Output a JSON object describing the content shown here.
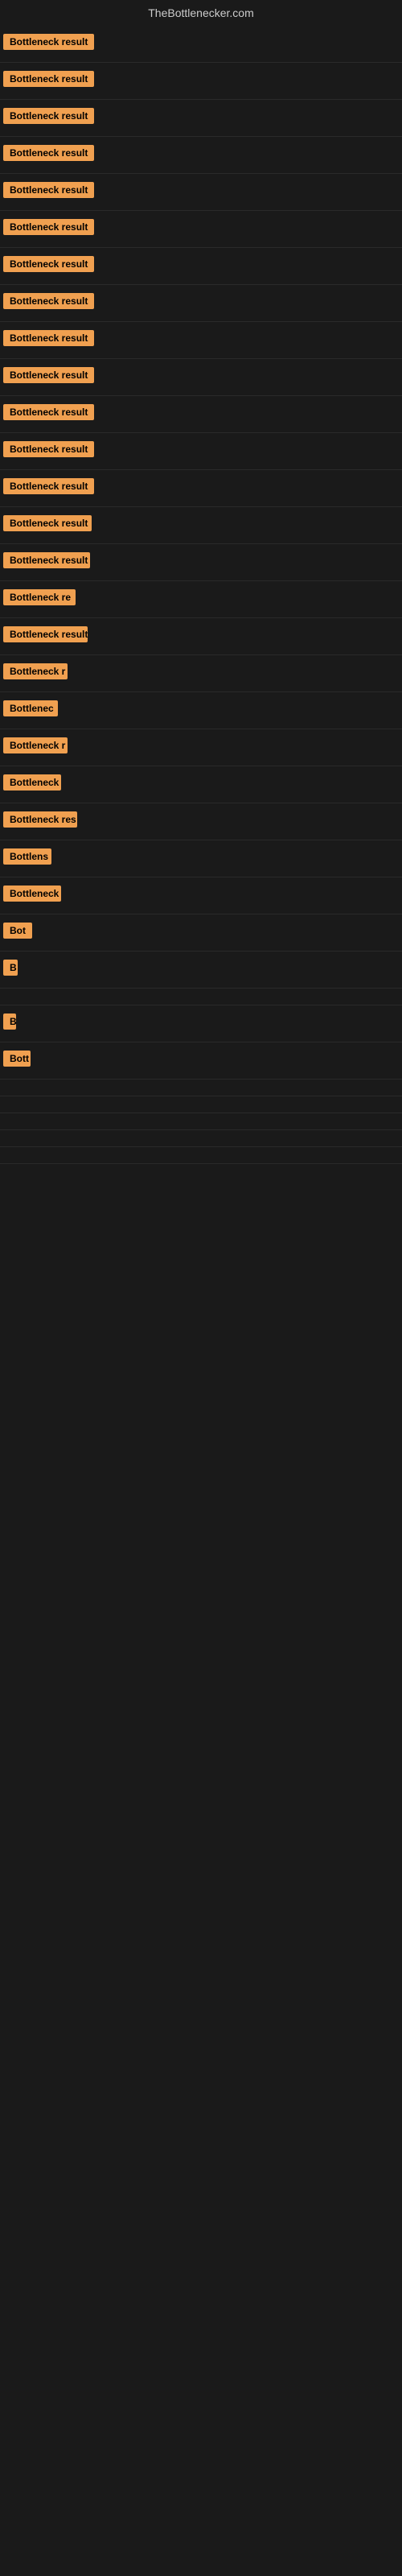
{
  "site": {
    "title": "TheBottlenecker.com"
  },
  "rows": [
    {
      "id": 1,
      "label": "Bottleneck result",
      "width": 140
    },
    {
      "id": 2,
      "label": "Bottleneck result",
      "width": 135
    },
    {
      "id": 3,
      "label": "Bottleneck result",
      "width": 130
    },
    {
      "id": 4,
      "label": "Bottleneck result",
      "width": 128
    },
    {
      "id": 5,
      "label": "Bottleneck result",
      "width": 130
    },
    {
      "id": 6,
      "label": "Bottleneck result",
      "width": 128
    },
    {
      "id": 7,
      "label": "Bottleneck result",
      "width": 128
    },
    {
      "id": 8,
      "label": "Bottleneck result",
      "width": 125
    },
    {
      "id": 9,
      "label": "Bottleneck result",
      "width": 123
    },
    {
      "id": 10,
      "label": "Bottleneck result",
      "width": 121
    },
    {
      "id": 11,
      "label": "Bottleneck result",
      "width": 120
    },
    {
      "id": 12,
      "label": "Bottleneck result",
      "width": 115
    },
    {
      "id": 13,
      "label": "Bottleneck result",
      "width": 113
    },
    {
      "id": 14,
      "label": "Bottleneck result",
      "width": 110
    },
    {
      "id": 15,
      "label": "Bottleneck result",
      "width": 108
    },
    {
      "id": 16,
      "label": "Bottleneck re",
      "width": 90
    },
    {
      "id": 17,
      "label": "Bottleneck result",
      "width": 105
    },
    {
      "id": 18,
      "label": "Bottleneck r",
      "width": 80
    },
    {
      "id": 19,
      "label": "Bottlenec",
      "width": 68
    },
    {
      "id": 20,
      "label": "Bottleneck r",
      "width": 80
    },
    {
      "id": 21,
      "label": "Bottleneck",
      "width": 72
    },
    {
      "id": 22,
      "label": "Bottleneck res",
      "width": 92
    },
    {
      "id": 23,
      "label": "Bottlens",
      "width": 60
    },
    {
      "id": 24,
      "label": "Bottleneck",
      "width": 72
    },
    {
      "id": 25,
      "label": "Bot",
      "width": 36
    },
    {
      "id": 26,
      "label": "B",
      "width": 18
    },
    {
      "id": 27,
      "label": "",
      "width": 0
    },
    {
      "id": 28,
      "label": "B",
      "width": 16
    },
    {
      "id": 29,
      "label": "Bott",
      "width": 34
    },
    {
      "id": 30,
      "label": "",
      "width": 0
    },
    {
      "id": 31,
      "label": "",
      "width": 0
    },
    {
      "id": 32,
      "label": "",
      "width": 0
    },
    {
      "id": 33,
      "label": "",
      "width": 0
    },
    {
      "id": 34,
      "label": "",
      "width": 0
    },
    {
      "id": 35,
      "label": "",
      "width": 0
    }
  ],
  "badge_color": "#f0a050"
}
